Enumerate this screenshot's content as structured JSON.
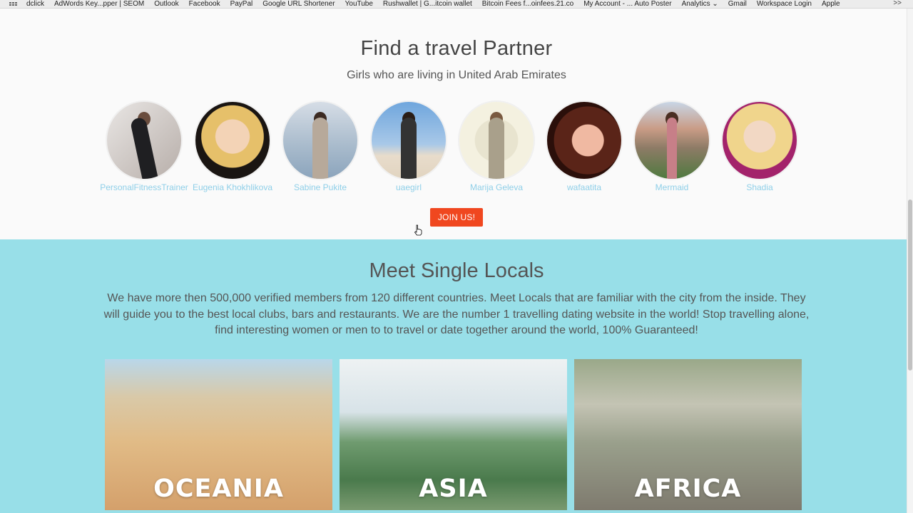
{
  "bookmarks": {
    "items": [
      "dclick",
      "AdWords Key...pper | SEOM",
      "Outlook",
      "Facebook",
      "PayPal",
      "Google URL Shortener",
      "YouTube",
      "Rushwallet | G...itcoin wallet",
      "Bitcoin Fees f...oinfees.21.co",
      "My Account - ... Auto Poster",
      "Analytics",
      "Gmail",
      "Workspace Login",
      "Apple"
    ],
    "more": ">>"
  },
  "partner": {
    "title": "Find a travel Partner",
    "subtitle": "Girls who are living in United Arab Emirates",
    "profiles": [
      {
        "name": "PersonalFitnessTrainer"
      },
      {
        "name": "Eugenia Khokhlikova"
      },
      {
        "name": "Sabine Pukite"
      },
      {
        "name": "uaegirl"
      },
      {
        "name": "Marija Geleva"
      },
      {
        "name": "wafaatita"
      },
      {
        "name": "Mermaid"
      },
      {
        "name": "Shadia"
      }
    ],
    "join_label": "JOIN US!"
  },
  "locals": {
    "title": "Meet Single Locals",
    "text": "We have more then 500,000 verified members from 120 different countries. Meet Locals that are familiar with the city from the inside. They will guide you to the best local clubs, bars and restaurants. We are the number 1 travelling dating website in the world! Stop travelling alone, find interesting women or men to to travel or date together around the world, 100% Guaranteed!",
    "regions": [
      {
        "label": "OCEANIA"
      },
      {
        "label": "ASIA"
      },
      {
        "label": "AFRICA"
      }
    ]
  }
}
